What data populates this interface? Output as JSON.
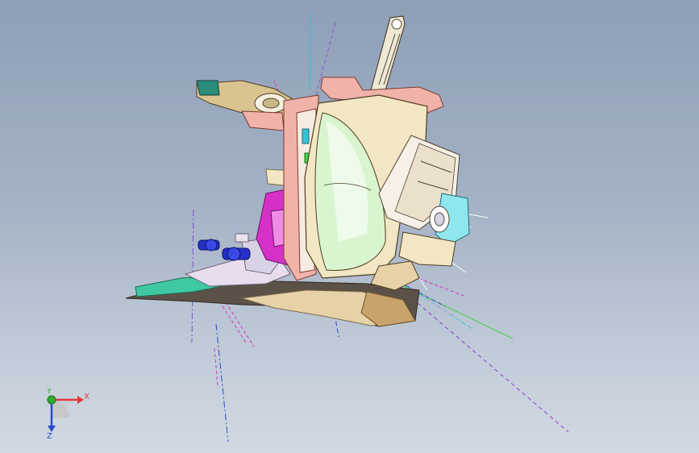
{
  "triad": {
    "x_label": "X",
    "y_label": "Y",
    "z_label": "Z",
    "x_color": "#e23b3b",
    "y_color": "#2fae2f",
    "z_color": "#2b4bd1"
  },
  "model": {
    "lens_color": "#d9f5d0",
    "housing_color": "#f3e6c4",
    "bracket_color": "#f1b3a9",
    "socket_color": "#d531c8",
    "bulb_color": "#2530c9",
    "cap_color": "#8fe6ee"
  }
}
